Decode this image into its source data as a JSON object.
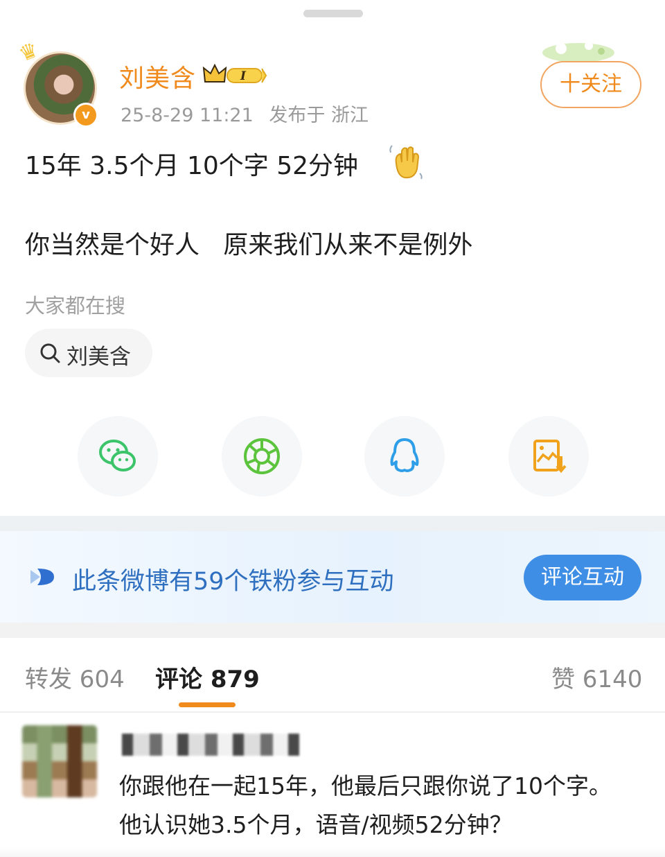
{
  "author": {
    "name": "刘美含",
    "vip_level": "I",
    "post_date": "25-8-29 11:21",
    "post_location": "发布于 浙江"
  },
  "follow_button_label": "十关注",
  "post": {
    "line1": "15年 3.5个月 10个字 52分钟",
    "line2": "你当然是个好人   原来我们从来不是例外",
    "emoji": "waving-hand-icon"
  },
  "hot_search": {
    "label": "大家都在搜",
    "chip_label": "刘美含"
  },
  "share_targets": [
    "wechat-icon",
    "moments-icon",
    "qq-icon",
    "save-image-icon"
  ],
  "fan_banner": {
    "text": "此条微博有59个铁粉参与互动",
    "button_label": "评论互动"
  },
  "tabs": {
    "repost": "转发 604",
    "comments": "评论 879",
    "likes": "赞 6140"
  },
  "comment": {
    "text": "你跟他在一起15年，他最后只跟你说了10个字。他认识她3.5个月，语音/视频52分钟？"
  },
  "colors": {
    "accent_orange": "#f08a1c",
    "link_blue": "#2e6fc0",
    "button_blue": "#3f8ee6"
  }
}
